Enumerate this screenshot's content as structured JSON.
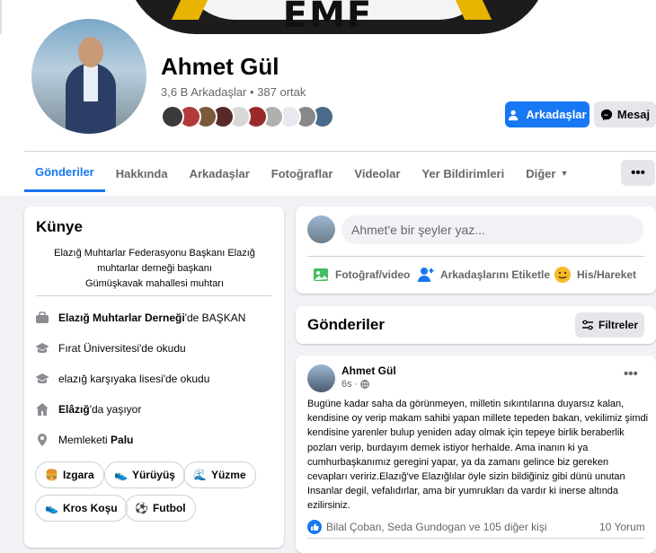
{
  "cover": {
    "text": "EMF"
  },
  "profile": {
    "name": "Ahmet Gül",
    "friends_summary": "3,6 B Arkadaşlar • 387 ortak",
    "friend_avatar_colors": [
      "#3a3a3a",
      "#b23a3a",
      "#7a5a3a",
      "#5a2a2a",
      "#d8d8d8",
      "#9a2a2a",
      "#b0b0b0",
      "#e8e8f0",
      "#888888",
      "#4a6a8a"
    ]
  },
  "actions": {
    "friends_label": "Arkadaşlar",
    "message_label": "Mesaj"
  },
  "tabs": [
    {
      "label": "Gönderiler",
      "active": true
    },
    {
      "label": "Hakkında",
      "active": false
    },
    {
      "label": "Arkadaşlar",
      "active": false
    },
    {
      "label": "Fotoğraflar",
      "active": false
    },
    {
      "label": "Videolar",
      "active": false
    },
    {
      "label": "Yer Bildirimleri",
      "active": false
    },
    {
      "label": "Diğer",
      "active": false
    }
  ],
  "more_button": "•••",
  "intro": {
    "title": "Künye",
    "bio_lines": [
      "Elazığ Muhtarlar Federasyonu Başkanı Elazığ",
      "muhtarlar derneği başkanı",
      "Gümüşkavak mahallesi muhtarı"
    ],
    "items": [
      {
        "icon": "briefcase-icon",
        "bold": "Elazığ Muhtarlar Derneği",
        "text": "'de BAŞKAN"
      },
      {
        "icon": "graduation-cap-icon",
        "bold": "",
        "text": "Fırat Üniversitesi'de okudu"
      },
      {
        "icon": "graduation-cap-icon",
        "bold": "",
        "text": "elazığ karşıyaka lisesi'de okudu"
      },
      {
        "icon": "home-icon",
        "bold": "Elâzığ",
        "text": "'da yaşıyor"
      },
      {
        "icon": "location-pin-icon",
        "bold": "Palu",
        "text": "Memleketi "
      }
    ],
    "hobbies": [
      "Izgara",
      "Yürüyüş",
      "Yüzme",
      "Kros Koşu",
      "Futbol"
    ]
  },
  "composer": {
    "placeholder": "Ahmet'e bir şeyler yaz...",
    "actions": [
      "Fotoğraf/video",
      "Arkadaşlarını Etiketle",
      "His/Hareket"
    ]
  },
  "posts_header": {
    "title": "Gönderiler",
    "filter_label": "Filtreler"
  },
  "post": {
    "author": "Ahmet Gül",
    "time": "6s ·",
    "text": "Bugüne kadar saha da görünmeyen, milletin sıkıntılarına duyarsız kalan, kendisine oy verip makam sahibi yapan millete tepeden bakan, vekilimiz şimdi kendisine yarenler bulup yeniden aday olmak için tepeye birlik beraberlik pozları verip, burdayım demek istiyor herhalde. Ama inanın ki ya cumhurbaşkanımız geregini yapar, ya da zamanı gelince biz gereken cevapları veririz.Elazığ've Elazığlılar öyle sizin bildiğiniz gibi dünü unutan Insanlar degil, vefalıdırlar, ama bir yumrukları da vardır ki inerse altında ezilirsiniz.",
    "reactions": "Bilal Çoban, Seda Gundogan ve 105 diğer kişi",
    "comments": "10 Yorum"
  },
  "colors": {
    "accent": "#1877f2",
    "background": "#f0f2f5"
  }
}
